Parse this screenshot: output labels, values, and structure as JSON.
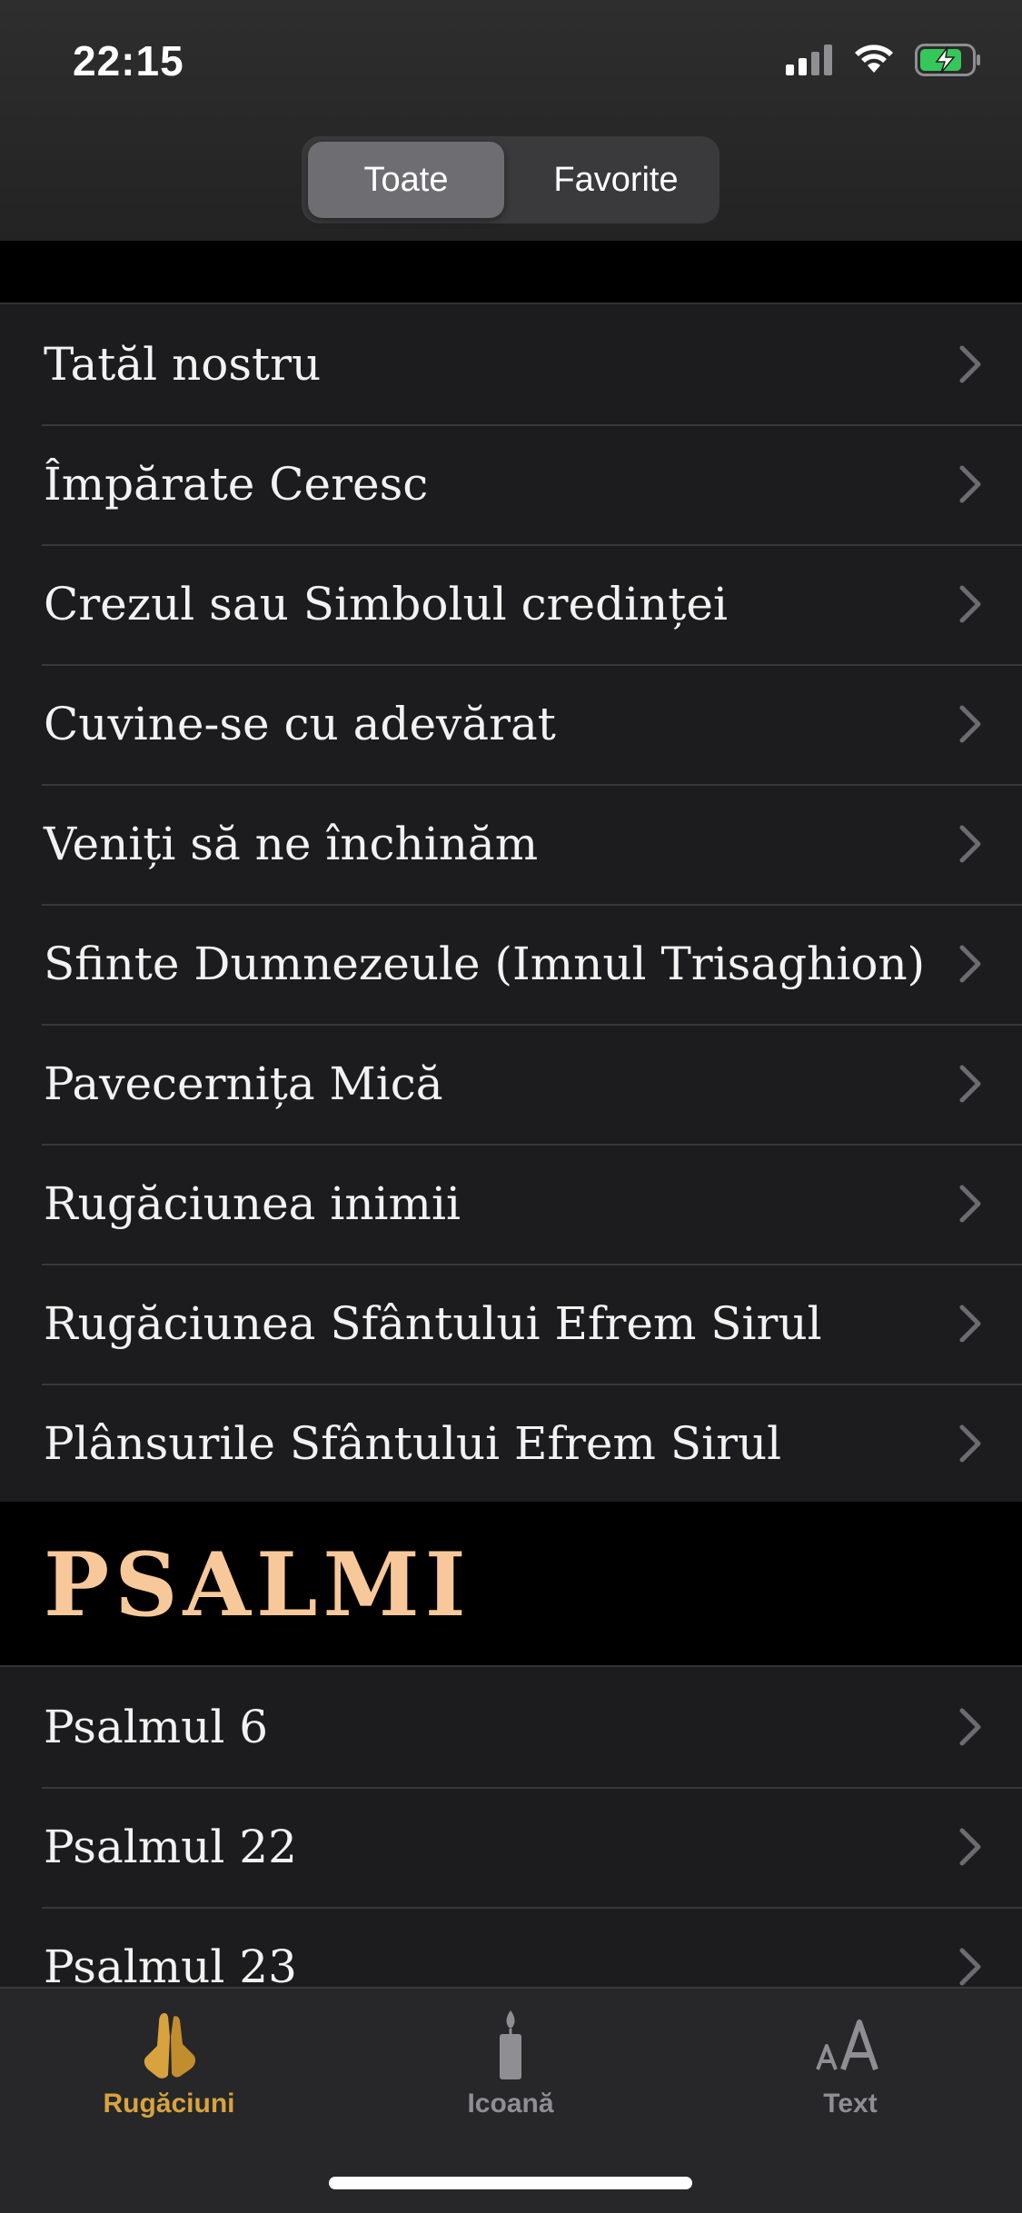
{
  "status_bar": {
    "time": "22:15"
  },
  "segmented_control": {
    "options": [
      "Toate",
      "Favorite"
    ],
    "selected": "Toate"
  },
  "prayers": [
    {
      "label": "Tatăl nostru"
    },
    {
      "label": "Împărate Ceresc"
    },
    {
      "label": "Crezul sau Simbolul credinței"
    },
    {
      "label": "Cuvine-se cu adevărat"
    },
    {
      "label": "Veniți să ne închinăm"
    },
    {
      "label": "Sfinte Dumnezeule (Imnul Trisaghion)"
    },
    {
      "label": "Pavecernița Mică"
    },
    {
      "label": "Rugăciunea inimii"
    },
    {
      "label": "Rugăciunea Sfântului Efrem Sirul"
    },
    {
      "label": "Plânsurile Sfântului Efrem Sirul"
    }
  ],
  "psalms_section": {
    "title": "PSALMI",
    "items": [
      {
        "label": "Psalmul 6"
      },
      {
        "label": "Psalmul 22"
      },
      {
        "label": "Psalmul 23"
      }
    ]
  },
  "tab_bar": {
    "tabs": [
      {
        "label": "Rugăciuni",
        "icon": "praying-hands-icon",
        "active": true
      },
      {
        "label": "Icoană",
        "icon": "candle-icon",
        "active": false
      },
      {
        "label": "Text",
        "icon": "text-size-icon",
        "active": false
      }
    ]
  },
  "colors": {
    "accent": "#d8a33f",
    "section_title": "#f7c89a",
    "background": "#000000",
    "row_background": "#1c1c1e"
  }
}
